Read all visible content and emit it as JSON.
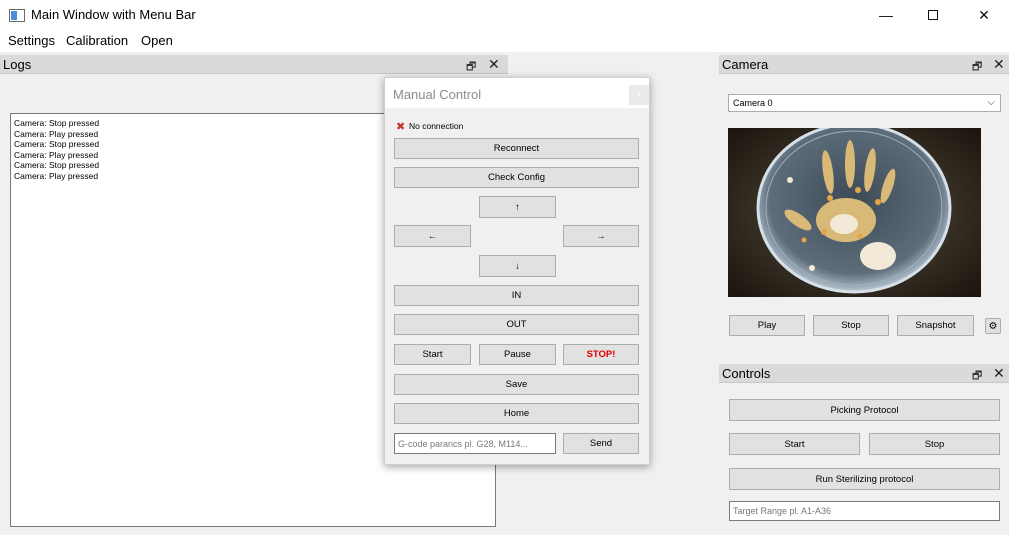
{
  "window": {
    "title": "Main Window with Menu Bar",
    "minimize_glyph": "—",
    "close_glyph": "✕"
  },
  "menu": {
    "items": [
      "Settings",
      "Calibration",
      "Open"
    ]
  },
  "logs": {
    "title": "Logs",
    "float_glyph": "🗗",
    "close_glyph": "✕",
    "lines": [
      "Camera: Stop pressed",
      "Camera: Play pressed",
      "Camera: Stop pressed",
      "Camera: Play pressed",
      "Camera: Stop pressed",
      "Camera: Play pressed"
    ]
  },
  "manual_control": {
    "title": "Manual Control",
    "close_glyph": "×",
    "status_icon": "x-mark-icon",
    "status_text": "No connection",
    "reconnect": "Reconnect",
    "check_config": "Check Config",
    "up": "↑",
    "left": "←",
    "right": "→",
    "down": "↓",
    "in": "IN",
    "out": "OUT",
    "start": "Start",
    "pause": "Pause",
    "stop": "STOP!",
    "save": "Save",
    "home": "Home",
    "gcode_placeholder": "G-code parancs pl. G28, M114...",
    "send": "Send",
    "stop_color": "#e00000"
  },
  "camera": {
    "title": "Camera",
    "float_glyph": "🗗",
    "close_glyph": "✕",
    "selected": "Camera 0",
    "play": "Play",
    "stop": "Stop",
    "snapshot": "Snapshot",
    "settings_glyph": "⚙"
  },
  "controls": {
    "title": "Controls",
    "float_glyph": "🗗",
    "close_glyph": "✕",
    "picking_protocol": "Picking Protocol",
    "start": "Start",
    "stop": "Stop",
    "run_sterilizing": "Run Sterilizing protocol",
    "target_placeholder": "Target Range pl. A1-A36"
  }
}
